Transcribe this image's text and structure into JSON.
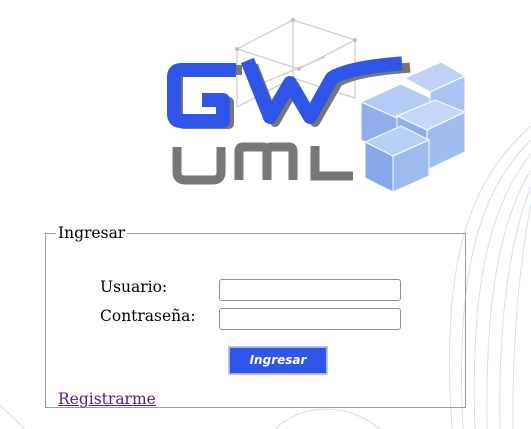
{
  "logo": {
    "mark_text": "GW",
    "sub_text": "UML",
    "colors": {
      "blue": "#2f55e9",
      "gray": "#777777",
      "cube": "#98b6f0"
    }
  },
  "login": {
    "legend": "Ingresar",
    "username_label": "Usuario:",
    "username_value": "",
    "password_label": "Contraseña:",
    "password_value": "",
    "submit_label": "Ingresar",
    "register_link": "Registrarme"
  },
  "colors": {
    "accent": "#2f55e9",
    "link": "#551a8b"
  }
}
